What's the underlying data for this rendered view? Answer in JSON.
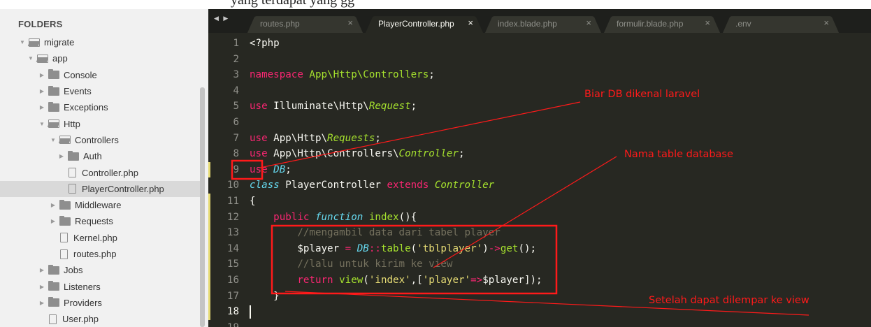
{
  "top_strip_text": "yang terdapat yang gg",
  "sidebar": {
    "header": "FOLDERS",
    "items": [
      {
        "label": "migrate",
        "kind": "folder",
        "open": true,
        "depth": 0
      },
      {
        "label": "app",
        "kind": "folder",
        "open": true,
        "depth": 1
      },
      {
        "label": "Console",
        "kind": "folder",
        "open": false,
        "depth": 2
      },
      {
        "label": "Events",
        "kind": "folder",
        "open": false,
        "depth": 2
      },
      {
        "label": "Exceptions",
        "kind": "folder",
        "open": false,
        "depth": 2
      },
      {
        "label": "Http",
        "kind": "folder",
        "open": true,
        "depth": 2
      },
      {
        "label": "Controllers",
        "kind": "folder",
        "open": true,
        "depth": 3
      },
      {
        "label": "Auth",
        "kind": "folder",
        "open": false,
        "depth": 4
      },
      {
        "label": "Controller.php",
        "kind": "file",
        "depth": 4
      },
      {
        "label": "PlayerController.php",
        "kind": "file",
        "depth": 4,
        "selected": true
      },
      {
        "label": "Middleware",
        "kind": "folder",
        "open": false,
        "depth": 3
      },
      {
        "label": "Requests",
        "kind": "folder",
        "open": false,
        "depth": 3
      },
      {
        "label": "Kernel.php",
        "kind": "file",
        "depth": 3
      },
      {
        "label": "routes.php",
        "kind": "file",
        "depth": 3
      },
      {
        "label": "Jobs",
        "kind": "folder",
        "open": false,
        "depth": 2
      },
      {
        "label": "Listeners",
        "kind": "folder",
        "open": false,
        "depth": 2
      },
      {
        "label": "Providers",
        "kind": "folder",
        "open": false,
        "depth": 2
      },
      {
        "label": "User.php",
        "kind": "file",
        "depth": 2
      }
    ]
  },
  "tabs": [
    {
      "label": "routes.php",
      "active": false
    },
    {
      "label": "PlayerController.php",
      "active": true
    },
    {
      "label": "index.blade.php",
      "active": false
    },
    {
      "label": "formulir.blade.php",
      "active": false
    },
    {
      "label": ".env",
      "active": false
    }
  ],
  "tab_close_glyph": "×",
  "code_lines": [
    {
      "n": "1",
      "tokens": [
        [
          "w",
          "<?php"
        ]
      ]
    },
    {
      "n": "2",
      "tokens": []
    },
    {
      "n": "3",
      "tokens": [
        [
          "k",
          "namespace"
        ],
        [
          "w",
          " "
        ],
        [
          "f",
          "App\\Http\\Controllers"
        ],
        [
          "w",
          ";"
        ]
      ]
    },
    {
      "n": "4",
      "tokens": []
    },
    {
      "n": "5",
      "tokens": [
        [
          "k",
          "use"
        ],
        [
          "w",
          " Illuminate\\Http\\"
        ],
        [
          "ti",
          "Request"
        ],
        [
          "w",
          ";"
        ]
      ]
    },
    {
      "n": "6",
      "tokens": []
    },
    {
      "n": "7",
      "tokens": [
        [
          "k",
          "use"
        ],
        [
          "w",
          " App\\Http\\"
        ],
        [
          "ti",
          "Requests"
        ],
        [
          "w",
          ";"
        ]
      ]
    },
    {
      "n": "8",
      "tokens": [
        [
          "k",
          "use"
        ],
        [
          "w",
          " App\\Http\\Controllers\\"
        ],
        [
          "ti",
          "Controller"
        ],
        [
          "w",
          ";"
        ]
      ]
    },
    {
      "n": "9",
      "tokens": [
        [
          "k",
          "use"
        ],
        [
          "w",
          " "
        ],
        [
          "t",
          "DB"
        ],
        [
          "w",
          ";"
        ]
      ],
      "modified": true
    },
    {
      "n": "10",
      "tokens": [
        [
          "t",
          "class"
        ],
        [
          "w",
          " PlayerController "
        ],
        [
          "k",
          "extends"
        ],
        [
          "w",
          " "
        ],
        [
          "ti",
          "Controller"
        ]
      ]
    },
    {
      "n": "11",
      "tokens": [
        [
          "w",
          "{"
        ]
      ],
      "modified": true
    },
    {
      "n": "12",
      "tokens": [
        [
          "w",
          "    "
        ],
        [
          "k",
          "public"
        ],
        [
          "w",
          " "
        ],
        [
          "t",
          "function"
        ],
        [
          "w",
          " "
        ],
        [
          "f",
          "index"
        ],
        [
          "w",
          "(){"
        ]
      ],
      "modified": true
    },
    {
      "n": "13",
      "tokens": [
        [
          "w",
          "        "
        ],
        [
          "c",
          "//mengambil data dari tabel player"
        ]
      ],
      "modified": true
    },
    {
      "n": "14",
      "tokens": [
        [
          "w",
          "        $player "
        ],
        [
          "k",
          "="
        ],
        [
          "w",
          " "
        ],
        [
          "t",
          "DB"
        ],
        [
          "k",
          "::"
        ],
        [
          "f",
          "table"
        ],
        [
          "w",
          "("
        ],
        [
          "s",
          "'tblplayer'"
        ],
        [
          "w",
          ")"
        ],
        [
          "k",
          "->"
        ],
        [
          "f",
          "get"
        ],
        [
          "w",
          "();"
        ]
      ],
      "modified": true
    },
    {
      "n": "15",
      "tokens": [
        [
          "w",
          "        "
        ],
        [
          "c",
          "//lalu untuk kirim ke view"
        ]
      ],
      "modified": true
    },
    {
      "n": "16",
      "tokens": [
        [
          "w",
          "        "
        ],
        [
          "k",
          "return"
        ],
        [
          "w",
          " "
        ],
        [
          "f",
          "view"
        ],
        [
          "w",
          "("
        ],
        [
          "s",
          "'index'"
        ],
        [
          "w",
          ",["
        ],
        [
          "s",
          "'player'"
        ],
        [
          "k",
          "=>"
        ],
        [
          "w",
          "$player]);"
        ]
      ],
      "modified": true
    },
    {
      "n": "17",
      "tokens": [
        [
          "w",
          "    }"
        ]
      ],
      "modified": true
    },
    {
      "n": "18",
      "tokens": [],
      "modified": true,
      "current": true
    },
    {
      "n": "19",
      "tokens": []
    }
  ],
  "annotations": {
    "note1": "Biar DB dikenal laravel",
    "note2": "Nama table database",
    "note3": "Setelah dapat dilempar ke view",
    "color": "#ff1a1a"
  },
  "nav_arrows": "◀ ▶"
}
